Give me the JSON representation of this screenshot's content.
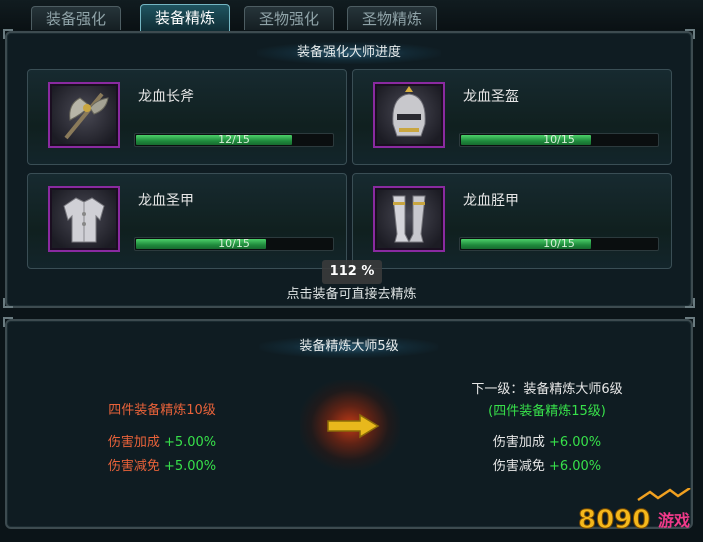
{
  "tabs": [
    {
      "label": "装备强化",
      "active": false
    },
    {
      "label": "装备精炼",
      "active": true
    },
    {
      "label": "圣物强化",
      "active": false
    },
    {
      "label": "圣物精炼",
      "active": false
    }
  ],
  "top_panel": {
    "title": "装备强化大师进度",
    "items": [
      {
        "name": "龙血长斧",
        "progress_text": "12/15",
        "progress": 0.8,
        "icon": "axe-icon"
      },
      {
        "name": "龙血圣盔",
        "progress_text": "10/15",
        "progress": 0.667,
        "icon": "helmet-icon"
      },
      {
        "name": "龙血圣甲",
        "progress_text": "10/15",
        "progress": 0.667,
        "icon": "armor-icon"
      },
      {
        "name": "龙血胫甲",
        "progress_text": "10/15",
        "progress": 0.667,
        "icon": "greaves-icon"
      }
    ],
    "hint": "点击装备可直接去精炼"
  },
  "zoom_label": "112 %",
  "bottom_panel": {
    "title": "装备精炼大师5级",
    "current": {
      "requirement": "四件装备精炼10级",
      "stats": [
        {
          "label": "伤害加成",
          "value": "+5.00%"
        },
        {
          "label": "伤害减免",
          "value": "+5.00%"
        }
      ]
    },
    "next": {
      "title": "下一级：装备精炼大师6级",
      "requirement": "(四件装备精炼15级)",
      "stats": [
        {
          "label": "伤害加成",
          "value": "+6.00%"
        },
        {
          "label": "伤害减免",
          "value": "+6.00%"
        }
      ]
    }
  },
  "watermark": {
    "digits": "8090",
    "text": "游戏"
  },
  "colors": {
    "accent_green": "#37e04a",
    "accent_red": "#e8623a",
    "frame_purple": "#8a2aa0",
    "arrow_gold": "#e8b81c"
  }
}
